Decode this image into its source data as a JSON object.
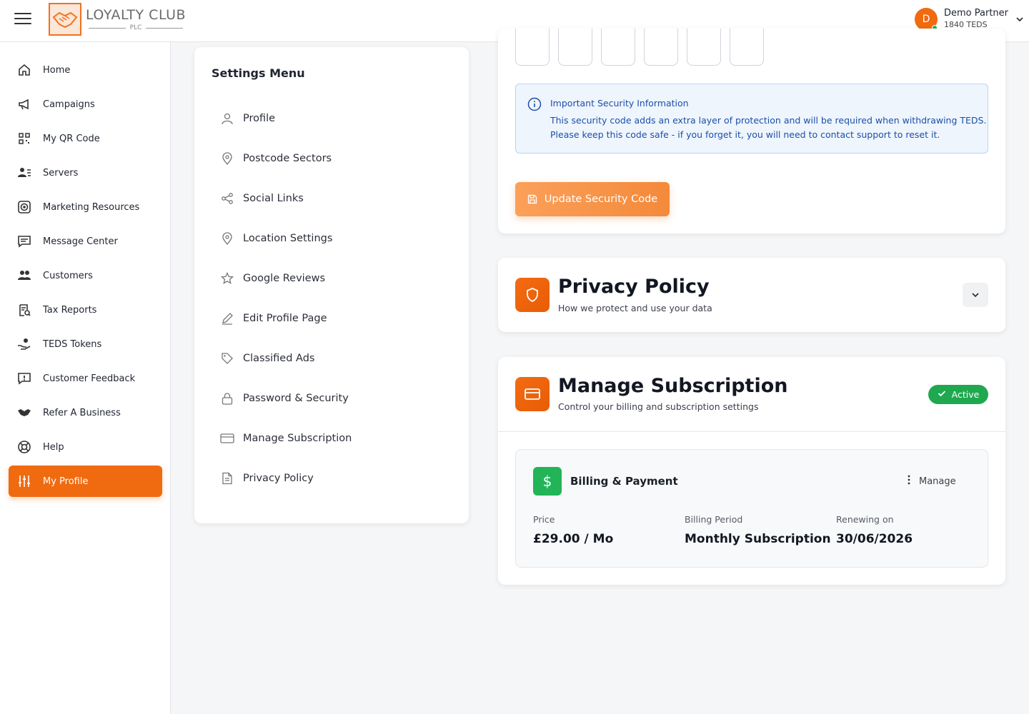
{
  "header": {
    "logo_name": "LOYALTY CLUB",
    "logo_sub": "PLC",
    "user_initial": "D",
    "user_name": "Demo Partner",
    "user_teds": "1840 TEDS"
  },
  "sidebar": {
    "items": [
      {
        "label": "Home",
        "icon": "home-icon"
      },
      {
        "label": "Campaigns",
        "icon": "megaphone-icon"
      },
      {
        "label": "My QR Code",
        "icon": "qr-code-icon"
      },
      {
        "label": "Servers",
        "icon": "servers-icon"
      },
      {
        "label": "Marketing Resources",
        "icon": "target-icon"
      },
      {
        "label": "Message Center",
        "icon": "message-icon"
      },
      {
        "label": "Customers",
        "icon": "customers-icon"
      },
      {
        "label": "Tax Reports",
        "icon": "tax-report-icon"
      },
      {
        "label": "TEDS Tokens",
        "icon": "tokens-icon"
      },
      {
        "label": "Customer Feedback",
        "icon": "feedback-icon"
      },
      {
        "label": "Refer A Business",
        "icon": "handshake-icon"
      },
      {
        "label": "Help",
        "icon": "lifebuoy-icon"
      },
      {
        "label": "My Profile",
        "icon": "sliders-icon"
      }
    ],
    "active": "My Profile"
  },
  "settings_menu": {
    "title": "Settings Menu",
    "items": [
      {
        "label": "Profile",
        "icon": "user-icon"
      },
      {
        "label": "Postcode Sectors",
        "icon": "map-pin-icon"
      },
      {
        "label": "Social Links",
        "icon": "share-icon"
      },
      {
        "label": "Location Settings",
        "icon": "location-icon"
      },
      {
        "label": "Google Reviews",
        "icon": "star-icon"
      },
      {
        "label": "Edit Profile Page",
        "icon": "pencil-icon"
      },
      {
        "label": "Classified Ads",
        "icon": "tag-icon"
      },
      {
        "label": "Password & Security",
        "icon": "lock-icon"
      },
      {
        "label": "Manage Subscription",
        "icon": "card-icon"
      },
      {
        "label": "Privacy Policy",
        "icon": "document-icon"
      }
    ]
  },
  "security": {
    "code_boxes": [
      "",
      "",
      "",
      "",
      "",
      ""
    ],
    "info_title": "Important Security Information",
    "info_line1": "This security code adds an extra layer of protection and will be required when withdrawing TEDS.",
    "info_line2": "Please keep this code safe - if you forget it, you will need to contact support to reset it.",
    "update_button": "Update Security Code"
  },
  "privacy": {
    "title": "Privacy Policy",
    "subtitle": "How we protect and use your data"
  },
  "subscription": {
    "title": "Manage Subscription",
    "subtitle": "Control your billing and subscription settings",
    "status": "Active",
    "billing_title": "Billing & Payment",
    "manage_label": "Manage",
    "price_label": "Price",
    "price_value": "£29.00 / Mo",
    "period_label": "Billing Period",
    "period_value": "Monthly Subscription",
    "renew_label": "Renewing on",
    "renew_value": "30/06/2026"
  },
  "colors": {
    "accent": "#f06a10",
    "success": "#1fa84f",
    "info_text": "#1d4fa8"
  }
}
